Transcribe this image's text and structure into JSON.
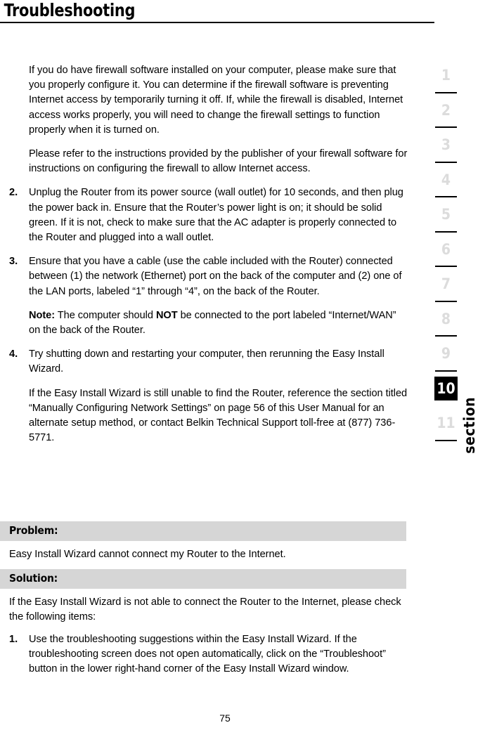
{
  "header": {
    "title": "Troubleshooting"
  },
  "content": {
    "intro_paragraphs": [
      "If you do have firewall software installed on your computer, please make sure that you properly configure it. You can determine if the firewall software is preventing Internet access by temporarily turning it off. If, while the firewall is disabled, Internet access works properly, you will need to change the firewall settings to function properly when it is turned on.",
      "Please refer to the instructions provided by the publisher of your firewall software for instructions on configuring the firewall to allow Internet access."
    ],
    "steps": [
      {
        "number": "2.",
        "text": "Unplug the Router from its power source (wall outlet) for 10 seconds, and then plug the power back in. Ensure that the Router’s power light is on; it should be solid green. If it is not, check to make sure that the AC adapter is properly connected to the Router and plugged into a wall outlet."
      },
      {
        "number": "3.",
        "text": "Ensure that you have a cable (use the cable included with the Router) connected between (1) the network (Ethernet) port on the back of the computer and (2) one of the LAN ports, labeled “1” through “4”, on the back of the Router.",
        "note_label": "Note:",
        "note_text_before": " The computer should ",
        "note_emphasis": "NOT",
        "note_text_after": " be connected to the port labeled “Internet/WAN” on the back of the Router."
      },
      {
        "number": "4.",
        "text": "Try shutting down and restarting your computer, then rerunning the Easy Install Wizard.",
        "sub_text": "If the Easy Install Wizard is still unable to find the Router, reference the section titled “Manually Configuring Network Settings” on page 56 of this User Manual for an alternate setup method, or contact Belkin Technical Support toll-free at (877) 736-5771."
      }
    ]
  },
  "qa": {
    "problem_label": "Problem:",
    "problem_text": "Easy Install Wizard cannot connect my Router to the Internet.",
    "solution_label": "Solution:",
    "solution_intro": "If the Easy Install Wizard is not able to connect the Router to the Internet, please check the following items:",
    "solution_steps": [
      {
        "number": "1.",
        "text": "Use the troubleshooting suggestions within the Easy Install Wizard. If the troubleshooting screen does not open automatically, click on the “Troubleshoot” button in the lower right-hand corner of the Easy Install Wizard window."
      }
    ]
  },
  "section_rail": {
    "numbers": [
      "1",
      "2",
      "3",
      "4",
      "5",
      "6",
      "7",
      "8",
      "9",
      "10",
      "11"
    ],
    "active": "10",
    "label": "section",
    "active_bg": "#000000",
    "inactive_color": "#dcdcdc"
  },
  "footer": {
    "page_number": "75"
  }
}
